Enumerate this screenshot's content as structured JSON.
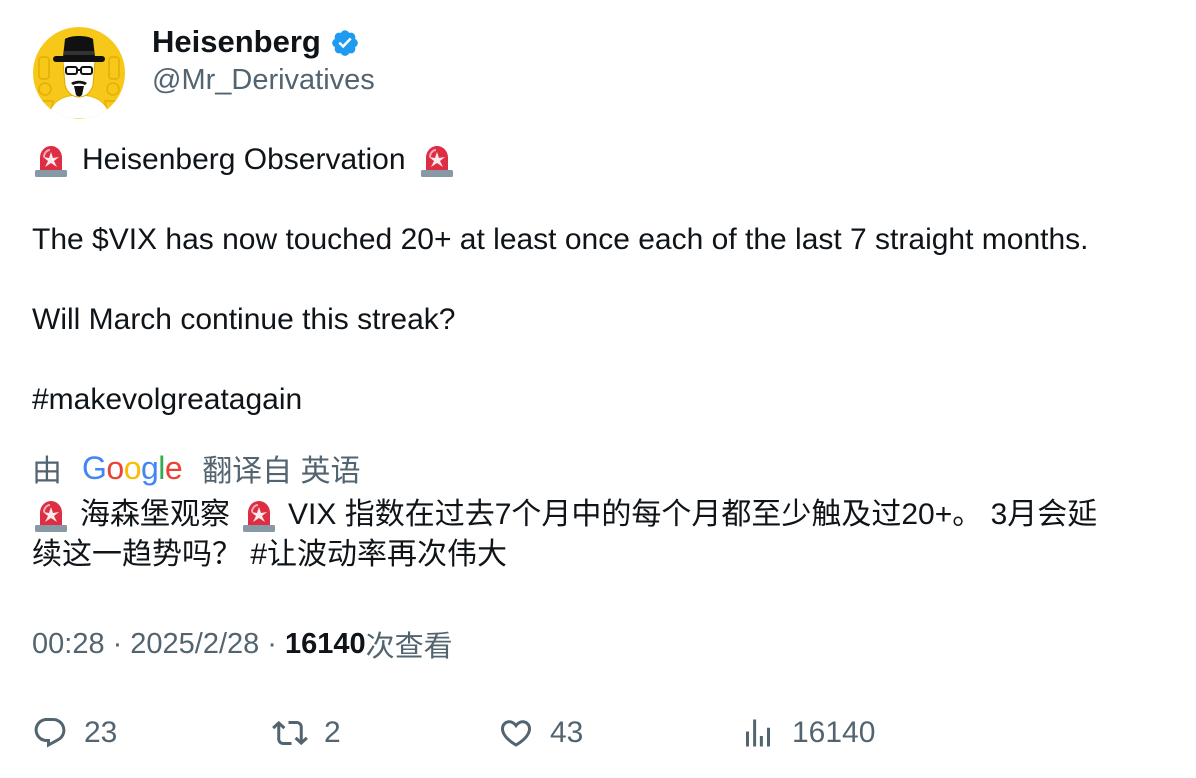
{
  "author": {
    "display_name": "Heisenberg",
    "handle": "@Mr_Derivatives",
    "verified": true,
    "verified_color": "#1d9bf0",
    "avatar_icon": "heisenberg-avatar-icon",
    "avatar_bg": "#f7c81a"
  },
  "tweet": {
    "line1_text": "Heisenberg Observation",
    "line2": "The $VIX has now touched 20+ at least once each of the last 7 straight months.",
    "line3": "Will March continue this streak?",
    "line4": "#makevolgreatagain",
    "emoji_icon": "siren-icon"
  },
  "translation": {
    "prefix": "由",
    "provider": "Google",
    "suffix": "翻译自 英语",
    "part1": "海森堡观察",
    "part2": "VIX 指数在过去7个月中的每个月都至少触及过20+。 3月会延",
    "line2": "续这一趋势吗？ #让波动率再次伟大"
  },
  "meta": {
    "time": "00:28",
    "separator": "·",
    "date": "2025/2/28",
    "views": "16140",
    "views_label": "次查看"
  },
  "actions": {
    "reply_count": "23",
    "retweet_count": "2",
    "like_count": "43",
    "views_count": "16140"
  },
  "colors": {
    "text": "#0f1419",
    "secondary": "#536471",
    "google_blue": "#4285f4",
    "google_red": "#ea4335",
    "google_yellow": "#fbbc05",
    "google_green": "#34a853"
  }
}
